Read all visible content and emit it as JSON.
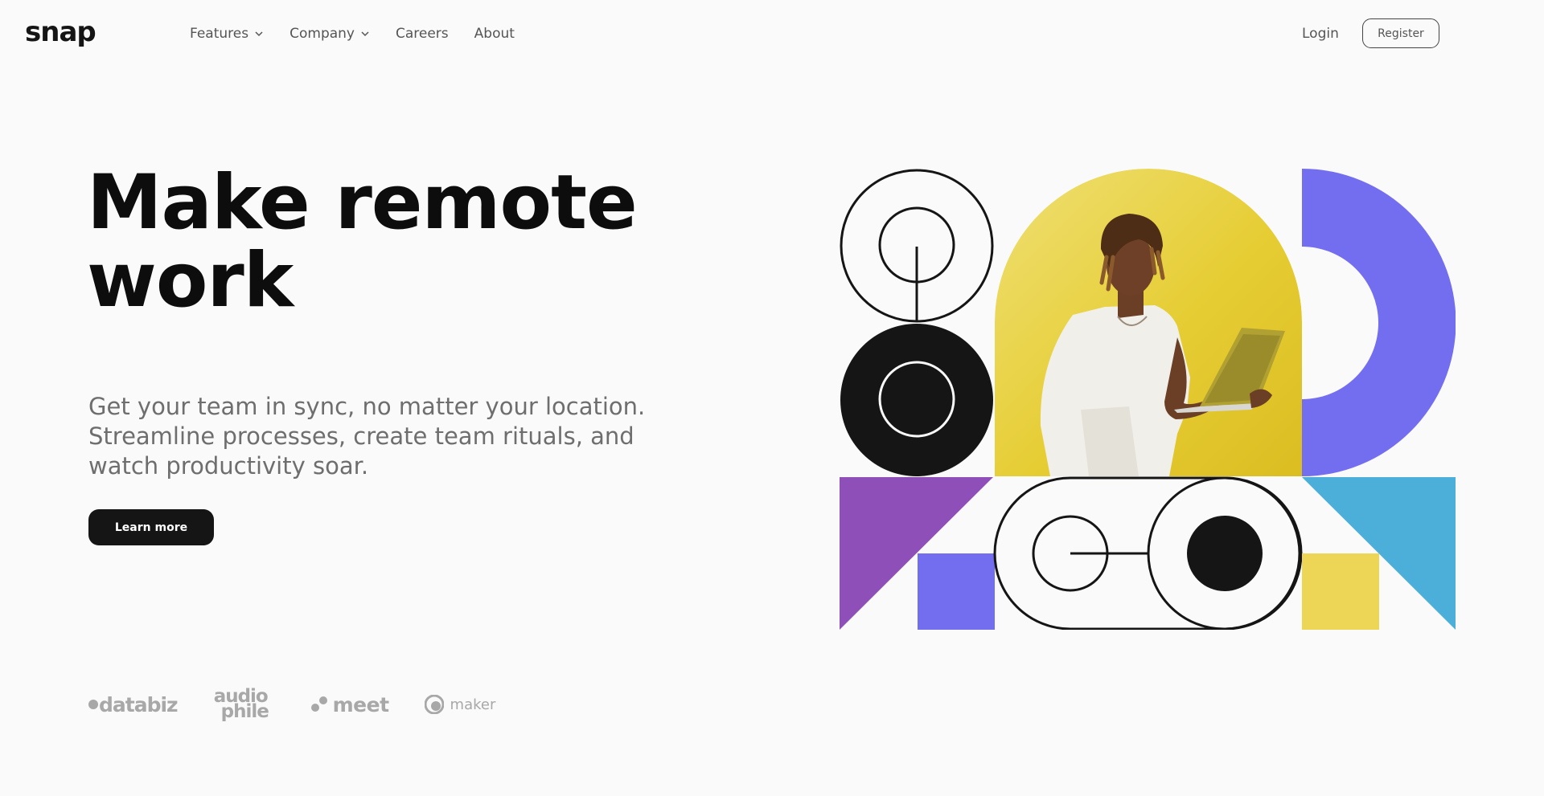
{
  "brand": {
    "logo_text": "snap"
  },
  "nav": {
    "items": [
      {
        "label": "Features",
        "has_dropdown": true
      },
      {
        "label": "Company",
        "has_dropdown": true
      },
      {
        "label": "Careers",
        "has_dropdown": false
      },
      {
        "label": "About",
        "has_dropdown": false
      }
    ],
    "login_label": "Login",
    "register_label": "Register"
  },
  "hero": {
    "title_line1": "Make remote",
    "title_line2": "work",
    "subtitle": "Get your team in sync, no matter your location. Streamline processes, create team rituals, and watch productivity soar.",
    "cta_label": "Learn more"
  },
  "clients": {
    "databiz": "databiz",
    "audiophile_top": "audio",
    "audiophile_bottom": "phile",
    "meet": "meet",
    "maker": "maker"
  },
  "colors": {
    "background": "#fafafa",
    "text": "#151515",
    "muted": "#6e6e6e",
    "yellow": "#e5cc2f",
    "blue_violet": "#736ef0",
    "purple": "#8e4fb8",
    "sky": "#4cafd9",
    "light_yellow": "#edd655"
  }
}
